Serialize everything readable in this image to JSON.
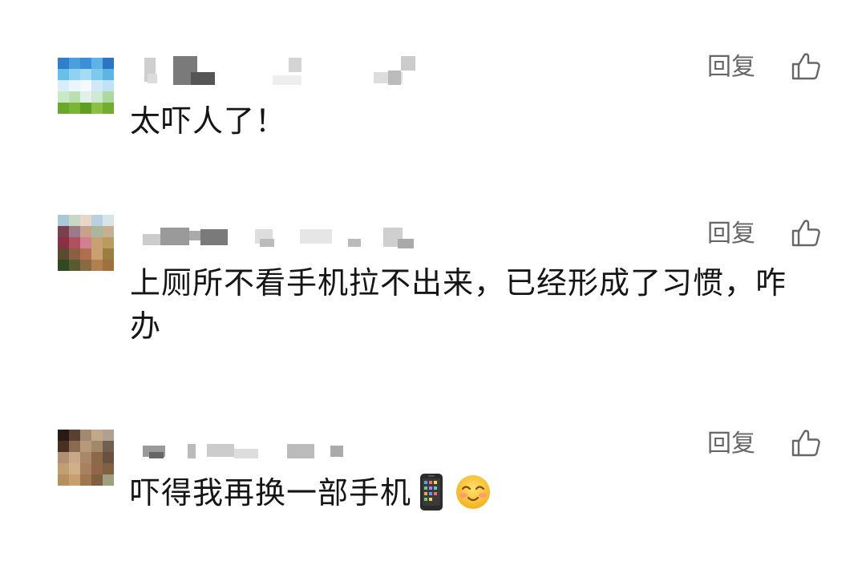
{
  "comments": [
    {
      "text": "太吓人了！",
      "reply_label": "回复",
      "avatar_colors": [
        "#2f7fc9",
        "#4aa0de",
        "#3b8fd6",
        "#5fb2e6",
        "#2a76c2",
        "#67c0ea",
        "#8fd3f1",
        "#a3dcf3",
        "#7ccbee",
        "#5bb6e3",
        "#d7eefa",
        "#eaf6fc",
        "#f3f9fd",
        "#cfe9f7",
        "#bfe3f5",
        "#c9e8c4",
        "#b9e0ae",
        "#dff1e8",
        "#cfe9d4",
        "#aed99c",
        "#6aa82c",
        "#7bb536",
        "#5e9e22",
        "#8cc043",
        "#72ad30"
      ]
    },
    {
      "text": "上厕所不看手机拉不出来，已经形成了习惯，咋办",
      "reply_label": "回复",
      "avatar_colors": [
        "#a8c9d8",
        "#c7d9c2",
        "#e6d7c9",
        "#b8d0e0",
        "#d9e3ea",
        "#7a4050",
        "#9b7a8a",
        "#c9a08a",
        "#a9b79a",
        "#c3b18f",
        "#8a3040",
        "#b05060",
        "#d08090",
        "#c9a070",
        "#b99a60",
        "#5a4a30",
        "#8a6040",
        "#b07050",
        "#c9a070",
        "#9a8040",
        "#2f4a20",
        "#5a5a30",
        "#8a6a40",
        "#b08050",
        "#a07040"
      ]
    },
    {
      "text": "吓得我再换一部手机",
      "reply_label": "回复",
      "avatar_colors": [
        "#2a1a14",
        "#5a4030",
        "#a08a70",
        "#c0a888",
        "#b0a090",
        "#4a3020",
        "#8a6a50",
        "#b89878",
        "#a08868",
        "#706050",
        "#b09070",
        "#c8a888",
        "#a88868",
        "#8a6a4a",
        "#6a5040",
        "#c0a070",
        "#d0b088",
        "#a88060",
        "#906848",
        "#806040",
        "#b89060",
        "#c8a070",
        "#a07850",
        "#806040",
        "#a0a080"
      ]
    }
  ],
  "icons": {
    "like": "thumbs-up-icon",
    "phone_emoji": "mobile-phone-emoji",
    "face_emoji": "smiling-face-emoji"
  }
}
